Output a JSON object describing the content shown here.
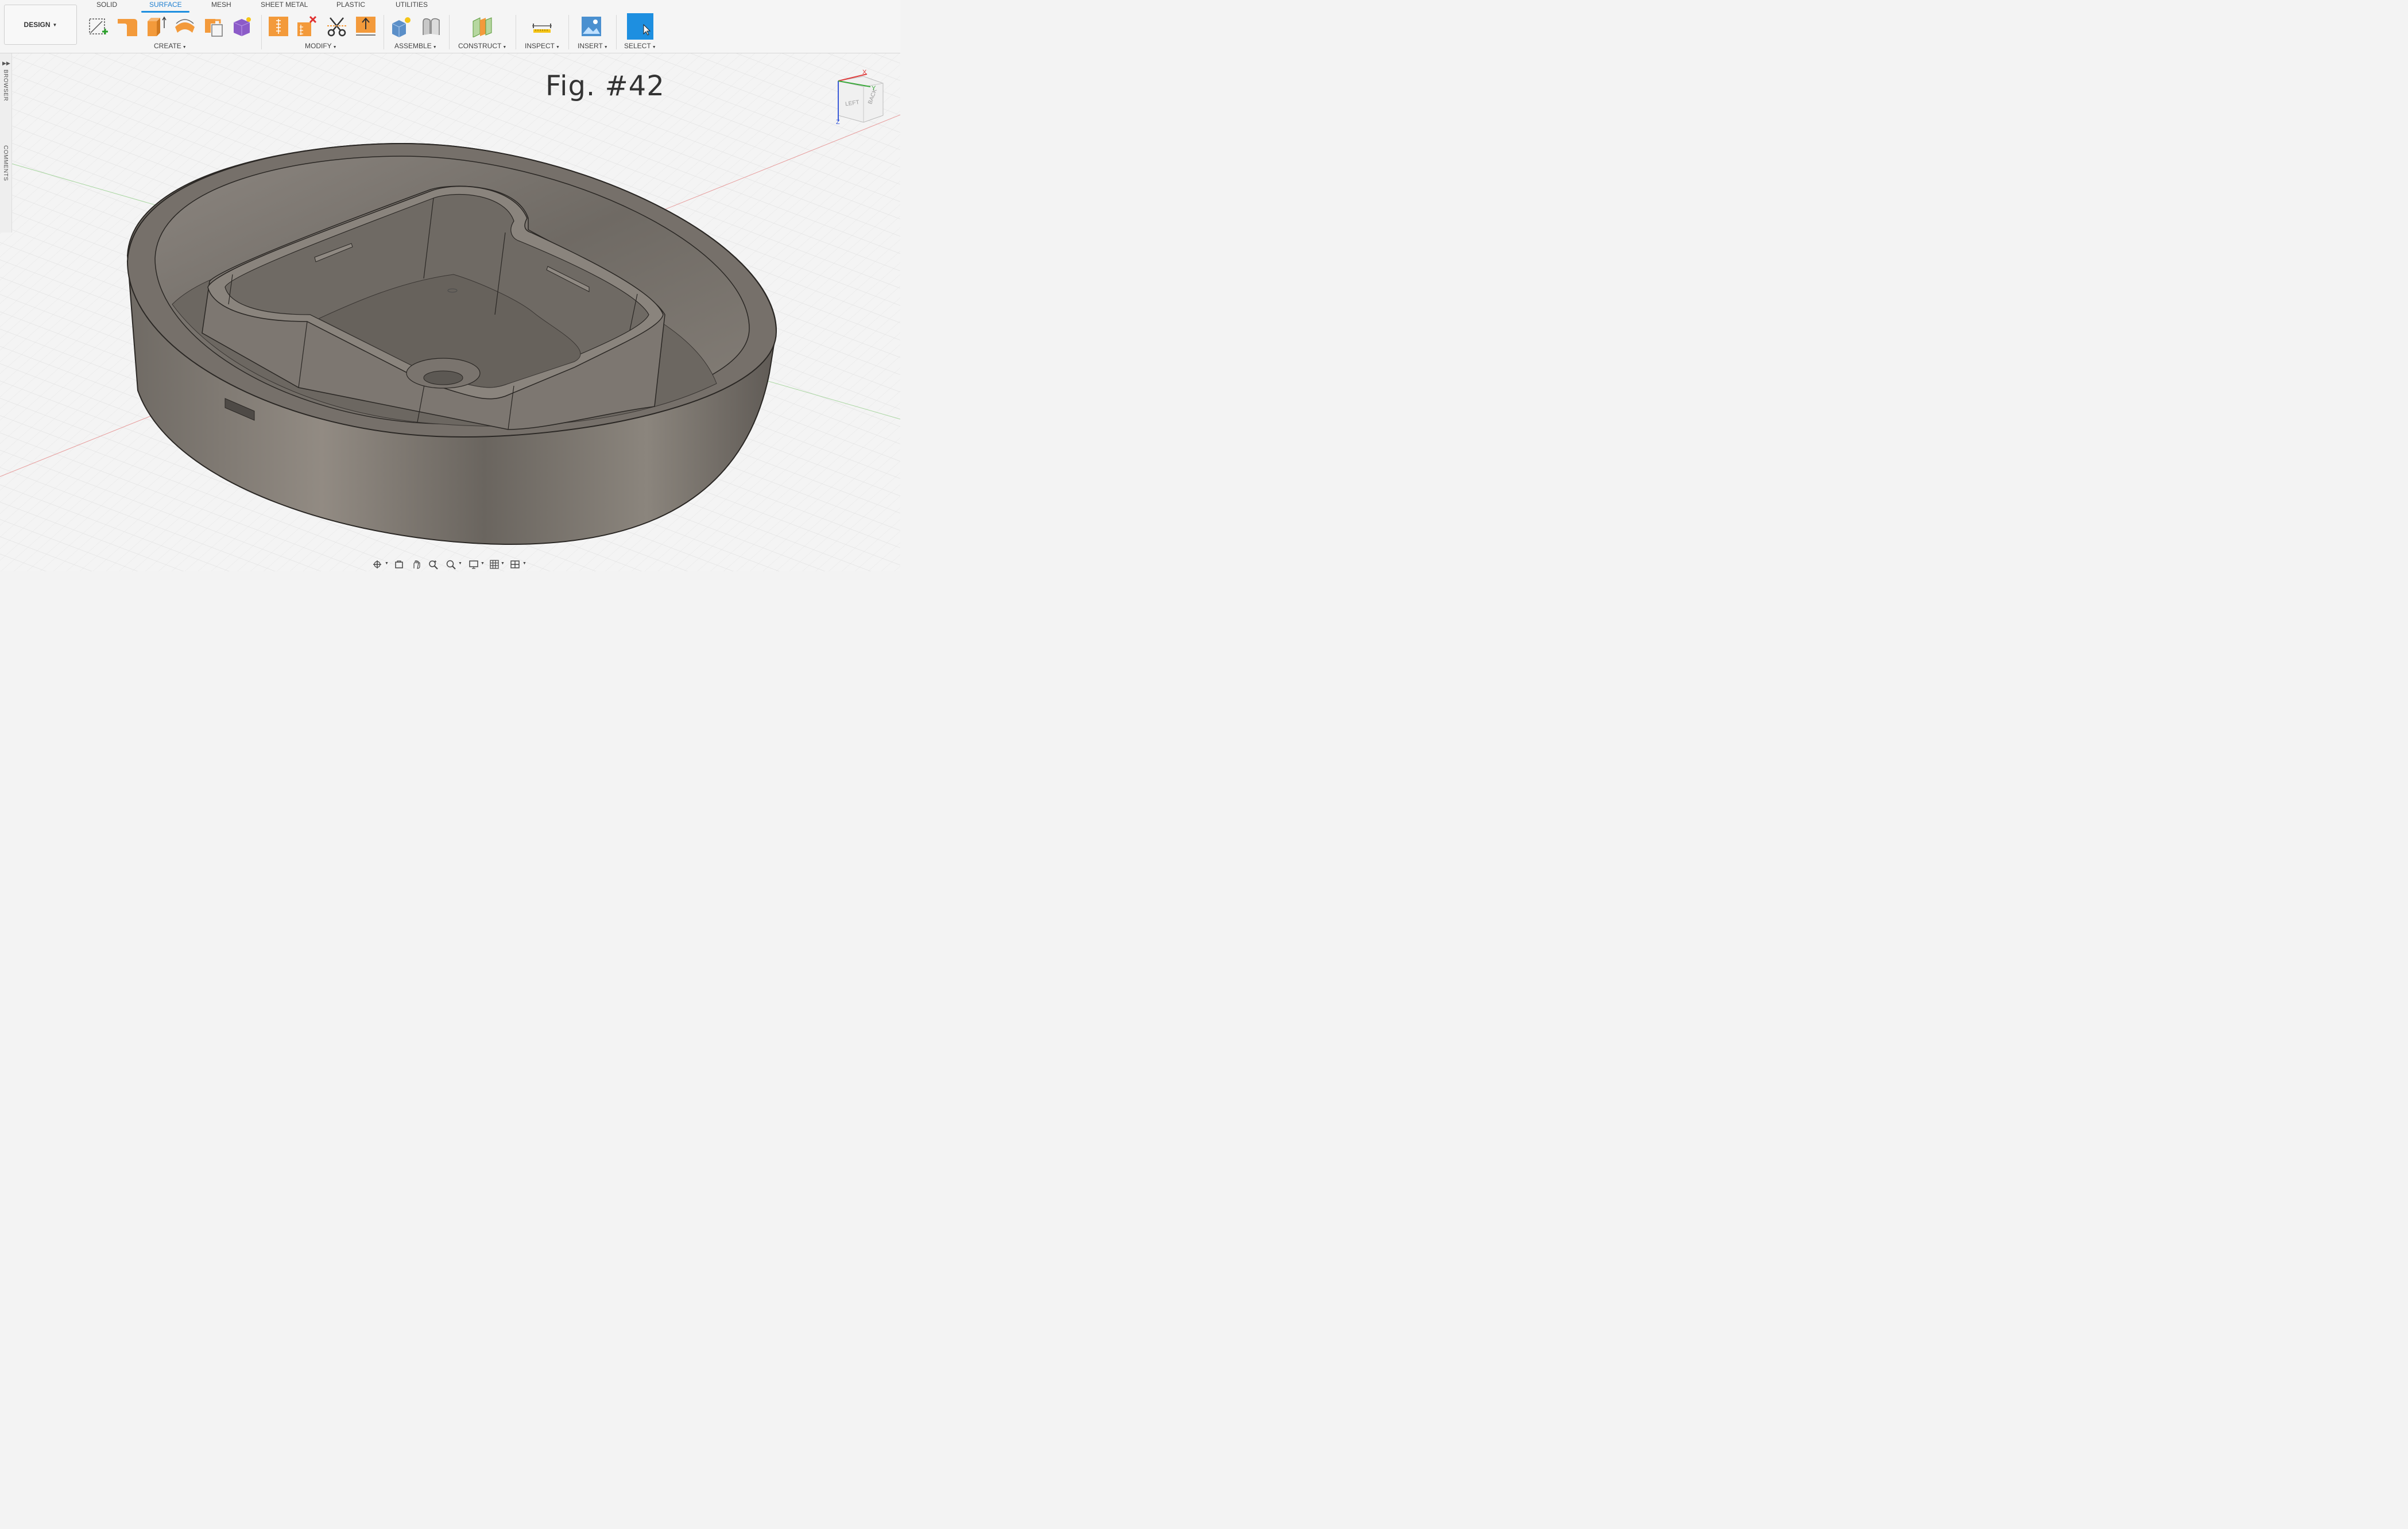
{
  "workspace": {
    "label": "DESIGN"
  },
  "tabs": [
    {
      "label": "SOLID",
      "active": false
    },
    {
      "label": "SURFACE",
      "active": true
    },
    {
      "label": "MESH",
      "active": false
    },
    {
      "label": "SHEET METAL",
      "active": false
    },
    {
      "label": "PLASTIC",
      "active": false
    },
    {
      "label": "UTILITIES",
      "active": false
    }
  ],
  "groups": {
    "create": "CREATE",
    "modify": "MODIFY",
    "assemble": "ASSEMBLE",
    "construct": "CONSTRUCT",
    "inspect": "INSPECT",
    "insert": "INSERT",
    "select": "SELECT"
  },
  "sidebar": {
    "browser": "BROWSER",
    "comments": "COMMENTS"
  },
  "figure_label": "Fig.  #42",
  "viewcube": {
    "faces": [
      "LEFT",
      "BACK"
    ],
    "axes": [
      "X",
      "Y",
      "Z"
    ]
  },
  "colors": {
    "accent": "#1e8fe0",
    "tool_orange": "#f39a3b",
    "model": "#76706a",
    "select_button": "#1e8fe0"
  },
  "icons": [
    "create-sketch-icon",
    "patch-icon",
    "extrude-icon",
    "revolve-icon",
    "offset-icon",
    "form-icon",
    "stitch-icon",
    "unstitch-icon",
    "trim-icon",
    "thicken-icon",
    "new-component-icon",
    "joint-icon",
    "offset-plane-icon",
    "measure-icon",
    "insert-canvas-icon",
    "select-icon",
    "orbit-icon",
    "look-at-icon",
    "pan-icon",
    "zoom-icon",
    "zoom-window-icon",
    "display-icon",
    "grid-icon",
    "viewports-icon"
  ]
}
